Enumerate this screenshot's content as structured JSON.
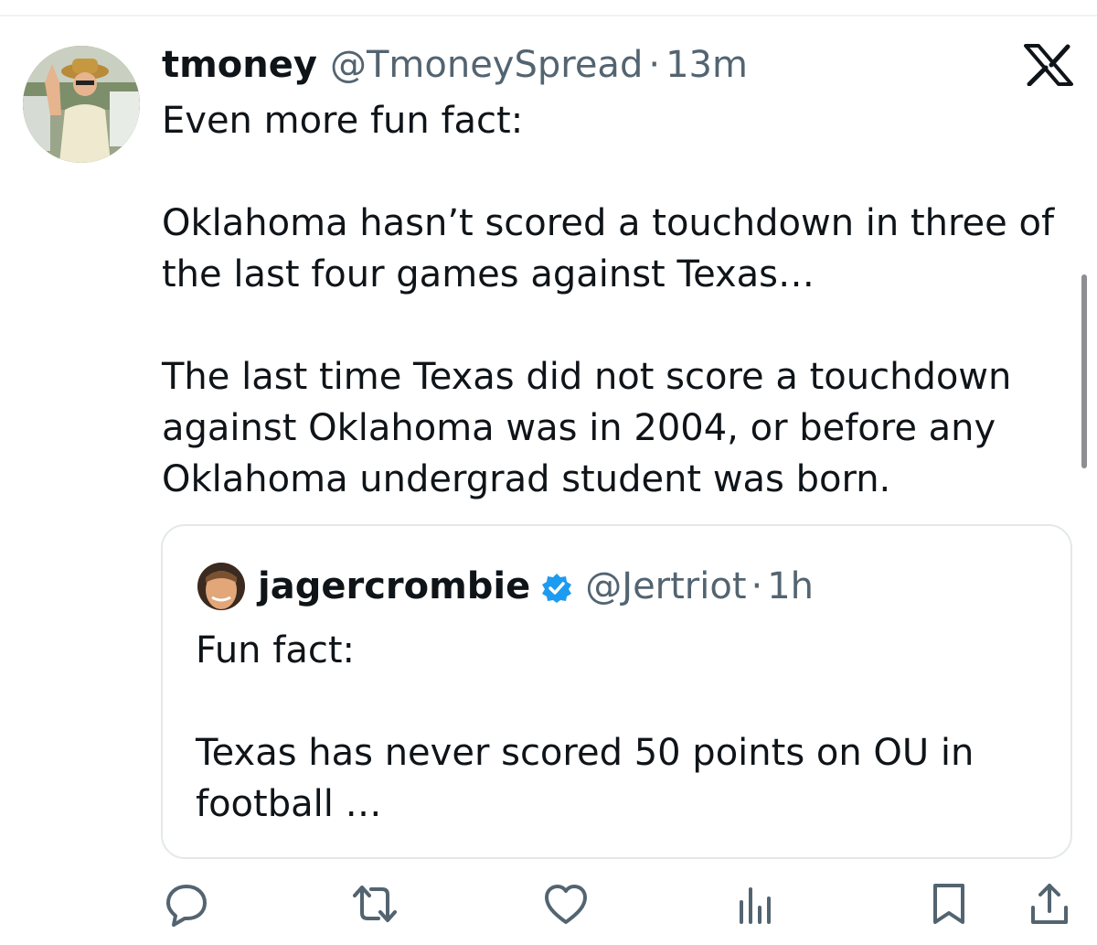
{
  "tweet": {
    "display_name": "tmoney",
    "handle": "@TmoneySpread",
    "separator": "·",
    "time": "13m",
    "text_lines": [
      "Even more fun fact:",
      "Oklahoma hasn’t scored a touchdown in three of the last four games against Texas…",
      "The last time Texas did not score a touchdown against Oklahoma was in 2004, or before any Oklahoma undergrad student was born."
    ]
  },
  "quoted_tweet": {
    "display_name": "jagercrombie",
    "handle": "@Jertriot",
    "separator": "·",
    "time": "1h",
    "text_lines": [
      "Fun fact:",
      "Texas has never scored 50 points on OU in football …"
    ]
  },
  "colors": {
    "text_primary": "#0f1419",
    "text_secondary": "#536471",
    "verified_blue": "#1d9bf0",
    "border": "#e4e8ea"
  },
  "icons": {
    "brand": "x-logo-icon",
    "verified": "verified-badge-icon",
    "actions": [
      "reply-icon",
      "retweet-icon",
      "like-icon",
      "views-icon",
      "bookmark-icon",
      "share-icon"
    ]
  }
}
